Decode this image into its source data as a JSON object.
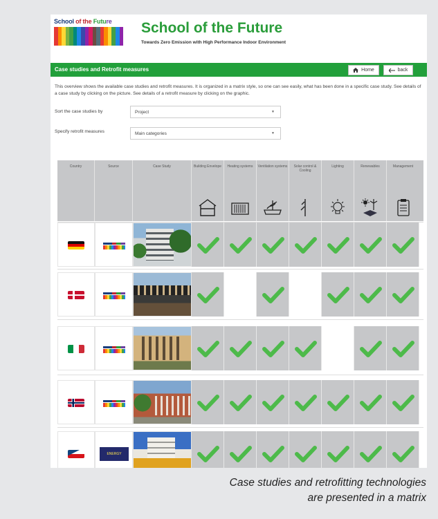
{
  "header": {
    "logo_text": [
      "School",
      " of the ",
      "Futu",
      "re"
    ],
    "title": "School of the Future",
    "subtitle": "Towards Zero Emission with High Performance Indoor Environment"
  },
  "bar": {
    "title": "Case studies and Retrofit measures",
    "home_label": "Home",
    "back_label": "back"
  },
  "intro": "This overview shows the available case studies and retrofit measures. It is organized in a matrix style, so one can see easily, what has been done in a specific case study. See details of a case study by clicking on the picture. See details of a retrofit measure by clicking on the graphic.",
  "sort": {
    "label": "Sort the case studies by",
    "value": "Project"
  },
  "specify": {
    "label": "Specify retrofit measures",
    "value": "Main categories"
  },
  "columns": {
    "country": "Country",
    "source": "Source",
    "case_study": "Case Study",
    "measures": [
      {
        "label": "Building Envelope",
        "icon": "house-envelope-icon"
      },
      {
        "label": "Heating systems",
        "icon": "radiator-icon"
      },
      {
        "label": "Ventilation systems",
        "icon": "ventilation-icon"
      },
      {
        "label": "Solar control & Cooling",
        "icon": "solar-shading-icon"
      },
      {
        "label": "Lighting",
        "icon": "light-bulb-icon"
      },
      {
        "label": "Renewables",
        "icon": "renewables-icon"
      },
      {
        "label": "Management",
        "icon": "clipboard-icon"
      }
    ]
  },
  "rows": [
    {
      "flag": "germany-flag",
      "source_logo": "school-of-the-future-logo",
      "photo": "case-study-photo-1",
      "checks": [
        true,
        true,
        true,
        true,
        true,
        true,
        true
      ]
    },
    {
      "flag": "denmark-flag",
      "source_logo": "school-of-the-future-logo",
      "photo": "case-study-photo-2",
      "checks": [
        true,
        false,
        true,
        false,
        true,
        true,
        true
      ]
    },
    {
      "flag": "italy-flag",
      "source_logo": "school-of-the-future-logo",
      "photo": "case-study-photo-3",
      "checks": [
        true,
        true,
        true,
        true,
        false,
        true,
        true
      ]
    },
    {
      "flag": "norway-flag",
      "source_logo": "school-of-the-future-logo",
      "photo": "case-study-photo-4",
      "checks": [
        true,
        true,
        true,
        true,
        true,
        true,
        true
      ]
    },
    {
      "flag": "czech-flag",
      "source_logo": "energy-house-logo",
      "photo": "case-study-photo-5",
      "checks": [
        true,
        true,
        true,
        true,
        true,
        true,
        true
      ]
    }
  ],
  "caption": [
    "Case studies and retrofitting technologies",
    "are presented in a matrix"
  ],
  "colors": {
    "brand_green": "#22a03b",
    "check_green": "#4dba4a",
    "matrix_grey": "#c6c7c9"
  }
}
